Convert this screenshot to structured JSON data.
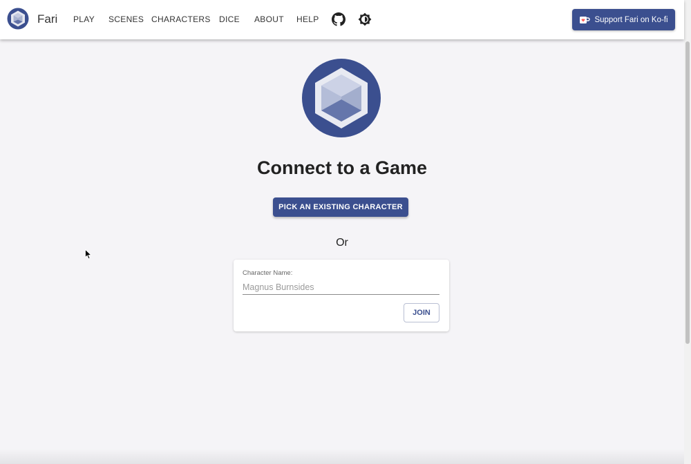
{
  "app": {
    "name": "Fari",
    "logo_icon": "fari-hexagon-logo"
  },
  "nav": {
    "items": [
      "PLAY",
      "SCENES",
      "CHARACTERS",
      "DICE",
      "ABOUT",
      "HELP"
    ],
    "github_icon": "github-icon",
    "theme_icon": "theme-toggle-icon"
  },
  "support": {
    "label": "Support Fari on Ko-fi",
    "icon": "kofi-cup-icon"
  },
  "main": {
    "title": "Connect to a Game",
    "pick_button": "PICK AN EXISTING CHARACTER",
    "or_text": "Or",
    "form": {
      "label": "Character Name:",
      "placeholder": "Magnus Burnsides",
      "value": "",
      "join_button": "JOIN"
    }
  },
  "colors": {
    "primary": "#3b4f8f",
    "background": "#f5f4f7",
    "logo_ring": "#3b4f8f"
  }
}
